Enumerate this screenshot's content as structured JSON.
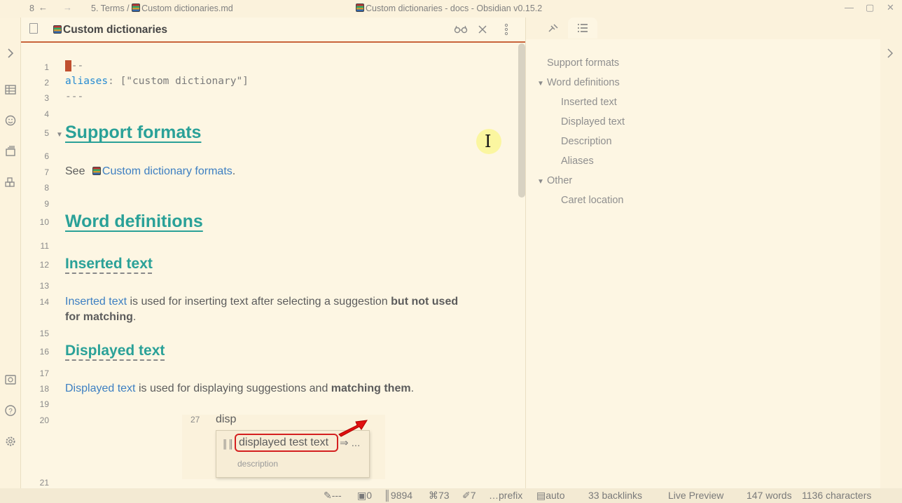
{
  "titlebar": {
    "nav_count": "8",
    "back_icon": "←",
    "forward_icon": "→",
    "breadcrumb_folder": "5. Terms /",
    "breadcrumb_file": "Custom dictionaries.md",
    "window_title": "Custom dictionaries - docs - Obsidian v0.15.2"
  },
  "tab": {
    "title": "Custom dictionaries",
    "icons": [
      "reading-view-icon",
      "close-icon",
      "more-options-icon"
    ]
  },
  "editor": {
    "frontmatter": {
      "dashes": "---",
      "key": "aliases",
      "colon": ":",
      "value": " [\"custom dictionary\"]"
    },
    "line_numbers": [
      "1",
      "2",
      "3",
      "4",
      "5",
      "6",
      "7",
      "8",
      "9",
      "10",
      "11",
      "12",
      "13",
      "14",
      "15",
      "16",
      "17",
      "18",
      "19",
      "20",
      "21"
    ],
    "h_support": "Support formats",
    "see_prefix": "See ",
    "see_link": "Custom dictionary formats",
    "see_suffix": ".",
    "h_word_defs": "Word definitions",
    "h_inserted": "Inserted text",
    "inserted_link": "Inserted text",
    "inserted_rest": " is used for inserting text after selecting a suggestion ",
    "inserted_bold1": "but not used",
    "inserted_bold2": "for matching",
    "inserted_end": ".",
    "h_displayed": "Displayed text",
    "displayed_link": "Displayed text",
    "displayed_rest": " is used for displaying suggestions and ",
    "displayed_bold": "matching them",
    "displayed_end": "."
  },
  "embedded_gif": {
    "line_number": "27",
    "typed_text": "disp",
    "suggestion": "displayed test text",
    "suggestion_tail": "⇒ ...",
    "description": "description",
    "arrow_color": "#e01010"
  },
  "outline": {
    "items": [
      {
        "label": "Support formats",
        "level": 1,
        "collapsible": false
      },
      {
        "label": "Word definitions",
        "level": 1,
        "collapsible": true
      },
      {
        "label": "Inserted text",
        "level": 2,
        "collapsible": false
      },
      {
        "label": "Displayed text",
        "level": 2,
        "collapsible": false
      },
      {
        "label": "Description",
        "level": 2,
        "collapsible": false
      },
      {
        "label": "Aliases",
        "level": 2,
        "collapsible": false
      },
      {
        "label": "Other",
        "level": 1,
        "collapsible": true
      },
      {
        "label": "Caret location",
        "level": 2,
        "collapsible": false
      }
    ]
  },
  "statusbar": {
    "s1": "---",
    "s2": "0",
    "s3": "9894",
    "s4": "73",
    "s5": "7",
    "s6": "prefix",
    "s7": "auto",
    "backlinks": "33 backlinks",
    "mode": "Live Preview",
    "words": "147 words",
    "chars": "1136 characters"
  },
  "colors": {
    "background": "#fdf6e3",
    "heading": "#2aa198",
    "link": "#3d7fc2",
    "accent": "#c8643b"
  }
}
